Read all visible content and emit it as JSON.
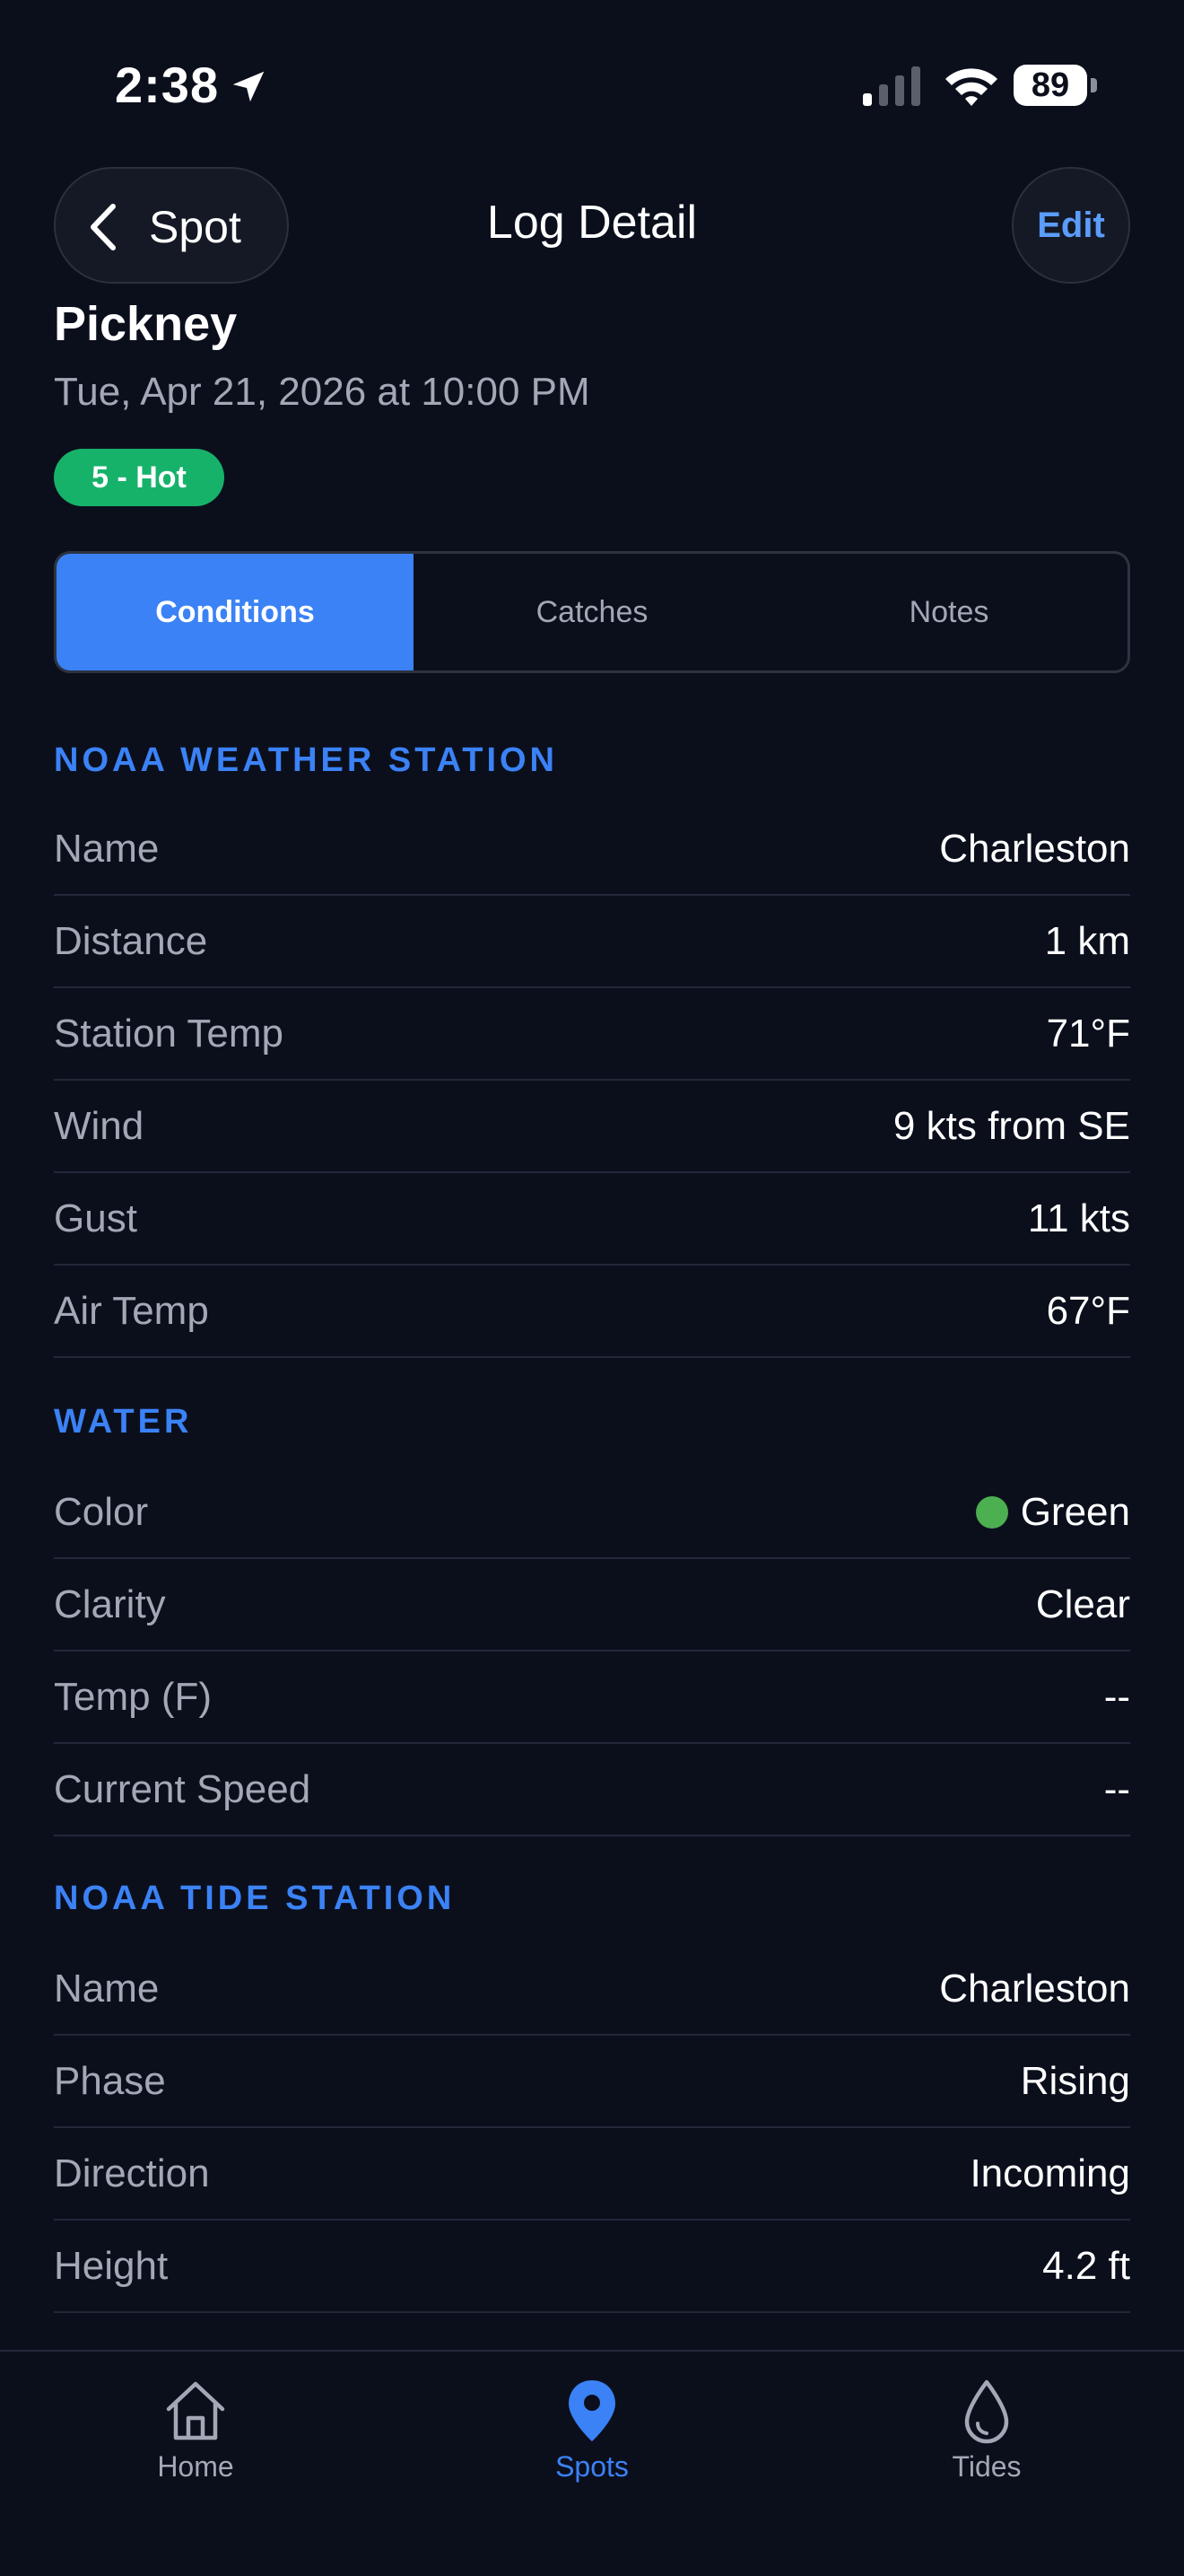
{
  "status_bar": {
    "time": "2:38",
    "battery": "89"
  },
  "nav": {
    "back_label": "Spot",
    "title": "Log Detail",
    "edit_label": "Edit"
  },
  "log": {
    "spot_name": "Pickney",
    "date": "Tue, Apr 21, 2026 at 10:00 PM",
    "rating": "5 - Hot"
  },
  "tabs": [
    {
      "label": "Conditions",
      "active": true
    },
    {
      "label": "Catches",
      "active": false
    },
    {
      "label": "Notes",
      "active": false
    }
  ],
  "weather": {
    "title": "NOAA WEATHER STATION",
    "rows": [
      {
        "label": "Name",
        "value": "Charleston"
      },
      {
        "label": "Distance",
        "value": "1 km"
      },
      {
        "label": "Station Temp",
        "value": "71°F"
      },
      {
        "label": "Wind",
        "value": "9 kts from SE"
      },
      {
        "label": "Gust",
        "value": "11 kts"
      },
      {
        "label": "Air Temp",
        "value": "67°F"
      }
    ]
  },
  "water": {
    "title": "WATER",
    "color_dot": "#4caf50",
    "rows": [
      {
        "label": "Color",
        "value": "Green"
      },
      {
        "label": "Clarity",
        "value": "Clear"
      },
      {
        "label": "Temp (F)",
        "value": "--"
      },
      {
        "label": "Current Speed",
        "value": "--"
      }
    ]
  },
  "tide": {
    "title": "NOAA TIDE STATION",
    "rows": [
      {
        "label": "Name",
        "value": "Charleston"
      },
      {
        "label": "Phase",
        "value": "Rising"
      },
      {
        "label": "Direction",
        "value": "Incoming"
      },
      {
        "label": "Height",
        "value": "4.2 ft"
      }
    ]
  },
  "tab_bar": [
    {
      "label": "Home",
      "icon": "home-icon",
      "active": false
    },
    {
      "label": "Spots",
      "icon": "map-pin-icon",
      "active": true
    },
    {
      "label": "Tides",
      "icon": "water-drop-icon",
      "active": false
    }
  ],
  "colors": {
    "accent": "#3b82f6",
    "background": "#0b0f1c",
    "badge": "#17b26a"
  }
}
